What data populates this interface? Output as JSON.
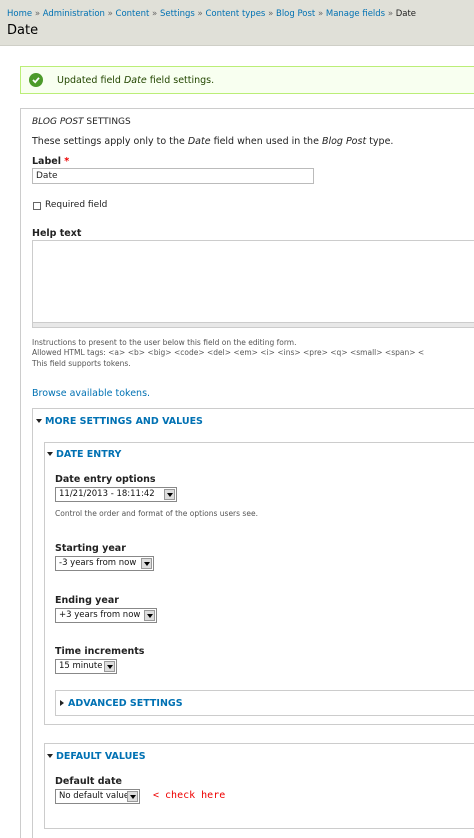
{
  "breadcrumb": {
    "items": [
      "Home",
      "Administration",
      "Content",
      "Settings",
      "Content types",
      "Blog Post",
      "Manage fields"
    ],
    "current": "Date",
    "separator": "»"
  },
  "page_title": "Date",
  "message": {
    "prefix": "Updated field ",
    "field": "Date",
    "suffix": " field settings.",
    "icon": "check-icon"
  },
  "settings": {
    "legend_prefix": "BLOG POST",
    "legend_suffix": " SETTINGS",
    "desc_prefix": "These settings apply only to the ",
    "desc_field": "Date",
    "desc_mid": " field when used in the ",
    "desc_type": "Blog Post",
    "desc_suffix": " type."
  },
  "label_field": {
    "label": "Label",
    "required_mark": "*",
    "value": "Date"
  },
  "required_field": {
    "label": "Required field",
    "checked": false
  },
  "help_text": {
    "label": "Help text",
    "value": "",
    "desc_1": "Instructions to present to the user below this field on the editing form.",
    "desc_2": "Allowed HTML tags: <a> <b> <big> <code> <del> <em> <i> <ins> <pre> <q> <small> <span> <",
    "desc_3": "This field supports tokens."
  },
  "browse_tokens": "Browse available tokens.",
  "more_settings": {
    "title": "More settings and values",
    "date_entry": {
      "title": "Date entry",
      "options_label": "Date entry options",
      "options_value": "11/21/2013 - 18:11:42",
      "options_desc": "Control the order and format of the options users see.",
      "starting_year_label": "Starting year",
      "starting_year_value": "-3 years from now",
      "ending_year_label": "Ending year",
      "ending_year_value": "+3 years from now",
      "time_increments_label": "Time increments",
      "time_increments_value": "15 minute",
      "advanced": "Advanced settings"
    },
    "default_values": {
      "title": "Default values",
      "default_date_label": "Default date",
      "default_date_value": "No default value",
      "annotation": "< check here"
    }
  },
  "colors": {
    "link": "#0071b3",
    "required": "#ee0000",
    "success_bg": "#f8fff0",
    "annotation": "#ee0000"
  }
}
